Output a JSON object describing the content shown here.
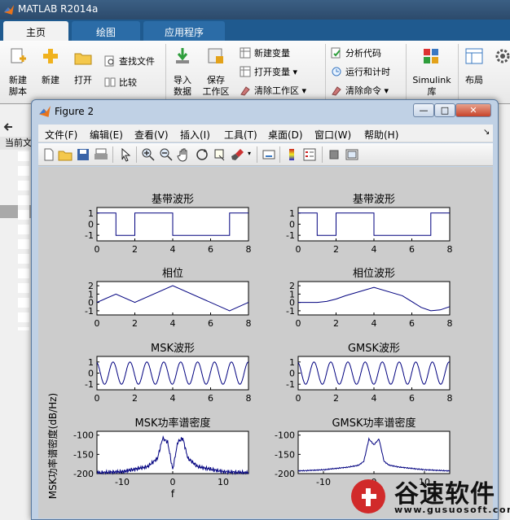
{
  "app": {
    "title": "MATLAB R2014a"
  },
  "tabs": [
    {
      "label": "主页"
    },
    {
      "label": "绘图"
    },
    {
      "label": "应用程序"
    }
  ],
  "ribbon": {
    "new_script": "新建\n脚本",
    "new": "新建",
    "open": "打开",
    "find_files": "查找文件",
    "compare": "比较",
    "import_data": "导入\n数据",
    "save_workspace": "保存\n工作区",
    "new_variable": "新建变量",
    "open_variable": "打开变量",
    "clear_workspace": "清除工作区",
    "analyze_code": "分析代码",
    "run_and_time": "运行和计时",
    "clear_commands": "清除命令",
    "simulink": "Simulink\n库",
    "layout": "布局"
  },
  "left_panel": {
    "current_folder": "当前文"
  },
  "figure": {
    "title": "Figure 2",
    "window_buttons": {
      "minimize": "—",
      "maximize": "□",
      "close": "✕"
    },
    "menu": [
      "文件(F)",
      "编辑(E)",
      "查看(V)",
      "插入(I)",
      "工具(T)",
      "桌面(D)",
      "窗口(W)",
      "帮助(H)"
    ]
  },
  "watermark": {
    "brand": "谷速软件",
    "url": "www.gusuosoft.com"
  },
  "chart_data": [
    {
      "type": "line",
      "title": "基带波形",
      "x": [
        0,
        1,
        1,
        2,
        2,
        4,
        4,
        7,
        7,
        8
      ],
      "y": [
        1,
        1,
        -1,
        -1,
        1,
        1,
        -1,
        -1,
        1,
        1
      ],
      "xlim": [
        0,
        8
      ],
      "ylim": [
        -1.5,
        1.5
      ],
      "xticks": [
        0,
        2,
        4,
        6,
        8
      ],
      "yticks": [
        -1,
        0,
        1
      ],
      "xlabel": "",
      "ylabel": ""
    },
    {
      "type": "line",
      "title": "基带波形",
      "x": [
        0,
        1,
        1,
        2,
        2,
        4,
        4,
        7,
        7,
        8
      ],
      "y": [
        1,
        1,
        -1,
        -1,
        1,
        1,
        -1,
        -1,
        1,
        1
      ],
      "xlim": [
        0,
        8
      ],
      "ylim": [
        -1.5,
        1.5
      ],
      "xticks": [
        0,
        2,
        4,
        6,
        8
      ],
      "yticks": [
        -1,
        0,
        1
      ],
      "xlabel": "",
      "ylabel": ""
    },
    {
      "type": "line",
      "title": "相位",
      "x": [
        0,
        1,
        2,
        4,
        7,
        8
      ],
      "y": [
        0,
        1,
        0,
        2,
        -1,
        0
      ],
      "xlim": [
        0,
        8
      ],
      "ylim": [
        -1.5,
        2.5
      ],
      "xticks": [
        0,
        2,
        4,
        6,
        8
      ],
      "yticks": [
        -1,
        0,
        1,
        2
      ],
      "xlabel": "",
      "ylabel": ""
    },
    {
      "type": "line",
      "title": "相位波形",
      "x": [
        0,
        1,
        1.5,
        2,
        2.5,
        4,
        5.5,
        6.5,
        7,
        7.5,
        8
      ],
      "y": [
        0,
        0,
        0.12,
        0.4,
        0.8,
        1.8,
        0.8,
        -0.6,
        -1.0,
        -0.9,
        -0.5
      ],
      "xlim": [
        0,
        8
      ],
      "ylim": [
        -1.5,
        2.5
      ],
      "xticks": [
        0,
        2,
        4,
        6,
        8
      ],
      "yticks": [
        -1,
        0,
        1,
        2
      ],
      "xlabel": "",
      "ylabel": ""
    },
    {
      "type": "line",
      "title": "MSK波形",
      "x": [],
      "y": [],
      "xlim": [
        0,
        8
      ],
      "ylim": [
        -1.5,
        1.5
      ],
      "xticks": [
        0,
        2,
        4,
        6,
        8
      ],
      "yticks": [
        -1,
        0,
        1
      ],
      "xlabel": "",
      "ylabel": ""
    },
    {
      "type": "line",
      "title": "GMSK波形",
      "x": [],
      "y": [],
      "xlim": [
        0,
        8
      ],
      "ylim": [
        -1.5,
        1.5
      ],
      "xticks": [
        0,
        2,
        4,
        6,
        8
      ],
      "yticks": [
        -1,
        0,
        1
      ],
      "xlabel": "",
      "ylabel": ""
    },
    {
      "type": "line",
      "title": "MSK功率谱密度",
      "x": [
        -15,
        -10,
        -5,
        -3,
        -2,
        -1,
        0,
        1,
        2,
        3,
        5,
        10,
        15
      ],
      "y": [
        -198,
        -195,
        -182,
        -160,
        -108,
        -118,
        -190,
        -118,
        -108,
        -160,
        -182,
        -195,
        -198
      ],
      "xlim": [
        -15,
        15
      ],
      "ylim": [
        -200,
        -90
      ],
      "xticks": [
        -10,
        0,
        10
      ],
      "yticks": [
        -200,
        -150,
        -100
      ],
      "xlabel": "f",
      "ylabel": "MSK功率谱密度(dB/Hz)"
    },
    {
      "type": "line",
      "title": "GMSK功率谱密度",
      "x": [
        -15,
        -10,
        -5,
        -3,
        -2,
        -1,
        0,
        1,
        2,
        3,
        5,
        10,
        15
      ],
      "y": [
        -193,
        -190,
        -183,
        -178,
        -168,
        -110,
        -125,
        -110,
        -168,
        -178,
        -183,
        -190,
        -193
      ],
      "xlim": [
        -15,
        15
      ],
      "ylim": [
        -200,
        -90
      ],
      "xticks": [
        -10,
        0,
        10
      ],
      "yticks": [
        -200,
        -150,
        -100
      ],
      "xlabel": "",
      "ylabel": ""
    }
  ]
}
